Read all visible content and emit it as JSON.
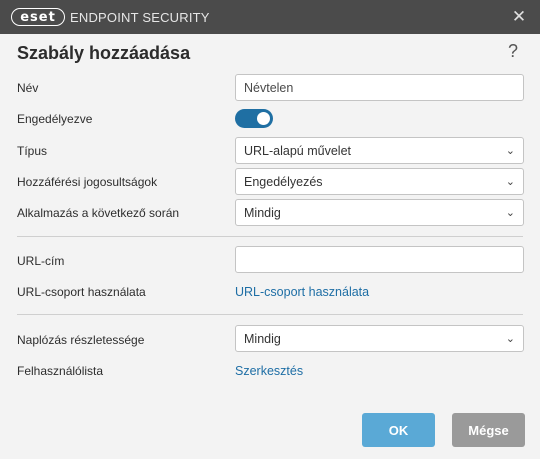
{
  "titlebar": {
    "logo_text": "eset",
    "product_name": "ENDPOINT SECURITY",
    "close_glyph": "✕"
  },
  "dialog": {
    "title": "Szabály hozzáadása",
    "help_glyph": "?"
  },
  "form": {
    "name": {
      "label": "Név",
      "value": "Névtelen"
    },
    "enabled": {
      "label": "Engedélyezve",
      "on": true
    },
    "type": {
      "label": "Típus",
      "value": "URL-alapú művelet"
    },
    "access": {
      "label": "Hozzáférési jogosultságok",
      "value": "Engedélyezés"
    },
    "apply": {
      "label": "Alkalmazás a következő során",
      "value": "Mindig"
    },
    "url": {
      "label": "URL-cím",
      "value": ""
    },
    "url_group": {
      "label": "URL-csoport használata",
      "link": "URL-csoport használata"
    },
    "logging": {
      "label": "Naplózás részletessége",
      "value": "Mindig"
    },
    "userlist": {
      "label": "Felhasználólista",
      "link": "Szerkesztés"
    }
  },
  "buttons": {
    "ok": "OK",
    "cancel": "Mégse"
  },
  "icons": {
    "chevron": "⌄"
  },
  "colors": {
    "titlebar": "#4b4b4b",
    "accent": "#1f6fa3",
    "link": "#1e6ea5",
    "ok_button": "#5aa9d6",
    "cancel_button": "#9a9a9a"
  }
}
